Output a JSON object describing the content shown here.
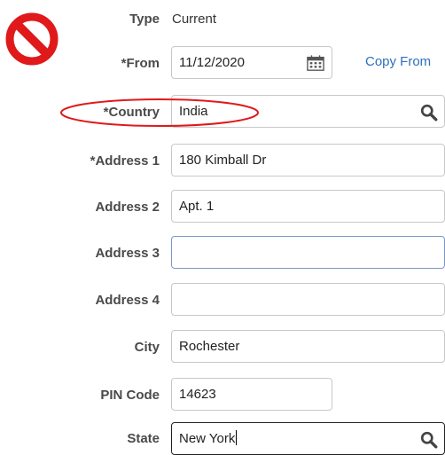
{
  "form": {
    "type": {
      "label": "Type",
      "value": "Current"
    },
    "from": {
      "label": "*From",
      "value": "11/12/2020"
    },
    "copy_from_link": "Copy From",
    "country": {
      "label": "*Country",
      "value": "India"
    },
    "address1": {
      "label": "*Address 1",
      "value": "180 Kimball Dr"
    },
    "address2": {
      "label": "Address 2",
      "value": "Apt. 1"
    },
    "address3": {
      "label": "Address 3",
      "value": ""
    },
    "address4": {
      "label": "Address 4",
      "value": ""
    },
    "city": {
      "label": "City",
      "value": "Rochester"
    },
    "pin_code": {
      "label": "PIN Code",
      "value": "14623"
    },
    "state": {
      "label": "State",
      "value": "New York"
    }
  },
  "colors": {
    "annotation_red": "#e0191b",
    "link_blue": "#2e6fbf"
  },
  "icons": {
    "prohibited": "prohibited-icon",
    "calendar": "calendar-icon",
    "search": "search-icon"
  }
}
